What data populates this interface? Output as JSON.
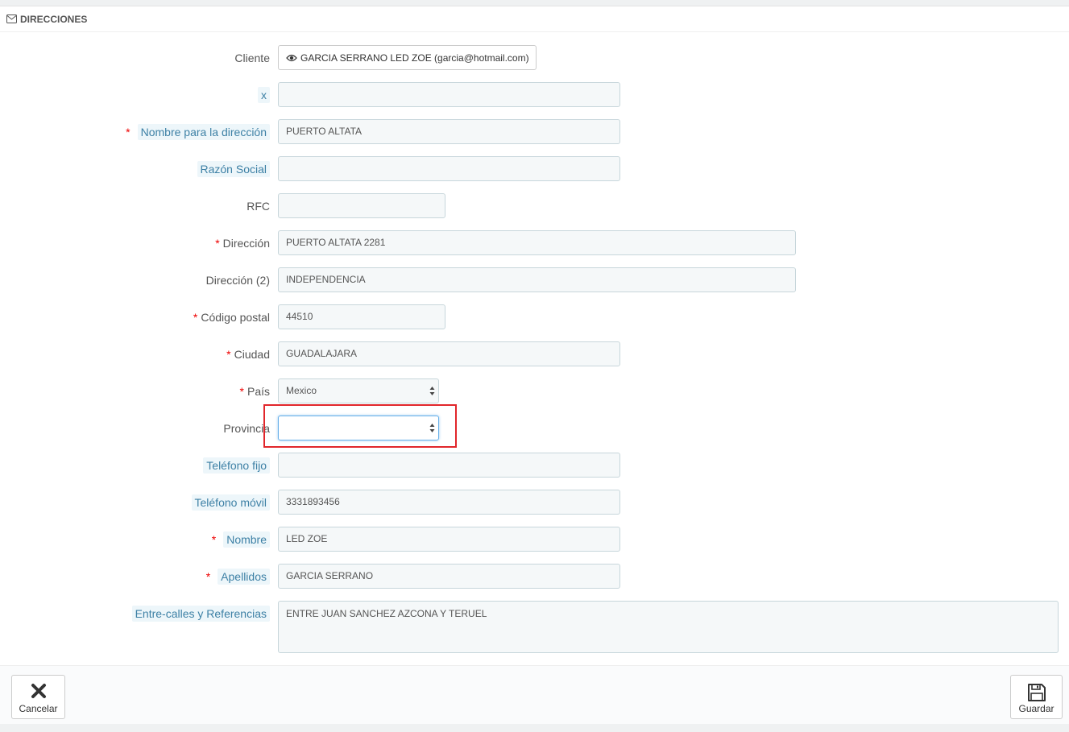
{
  "panel": {
    "title": "DIRECCIONES",
    "title_icon": "envelope-icon"
  },
  "form": {
    "cliente": {
      "label": "Cliente",
      "value": "GARCIA SERRANO LED ZOE (garcia@hotmail.com)",
      "icon": "eye-icon"
    },
    "x": {
      "label": "x",
      "value": ""
    },
    "alias": {
      "label": "Nombre para la dirección",
      "value": "PUERTO ALTATA",
      "required": true
    },
    "company": {
      "label": "Razón Social",
      "value": ""
    },
    "rfc": {
      "label": "RFC",
      "value": ""
    },
    "address1": {
      "label": "Dirección",
      "value": "PUERTO ALTATA 2281",
      "required": true
    },
    "address2": {
      "label": "Dirección (2)",
      "value": "INDEPENDENCIA"
    },
    "postcode": {
      "label": "Código postal",
      "value": "44510",
      "required": true
    },
    "city": {
      "label": "Ciudad",
      "value": "GUADALAJARA",
      "required": true
    },
    "country": {
      "label": "País",
      "value": "Mexico",
      "required": true
    },
    "state": {
      "label": "Provincia",
      "value": ""
    },
    "phone": {
      "label": "Teléfono fijo",
      "value": ""
    },
    "phone_mobile": {
      "label": "Teléfono móvil",
      "value": "3331893456"
    },
    "firstname": {
      "label": "Nombre",
      "value": "LED ZOE",
      "required": true
    },
    "lastname": {
      "label": "Apellidos",
      "value": "GARCIA SERRANO",
      "required": true
    },
    "other": {
      "label": "Entre-calles y Referencias",
      "value": "ENTRE JUAN SANCHEZ AZCONA Y TERUEL"
    },
    "required_marker": "*"
  },
  "footer": {
    "cancel_label": "Cancelar",
    "cancel_icon": "close-icon",
    "save_label": "Guardar",
    "save_icon": "save-icon"
  },
  "colors": {
    "required": "#e00000",
    "hint_text": "#3d80a5",
    "hint_bg": "#edf6fa",
    "field_bg": "#f5f8f9",
    "highlight": "#e1262b"
  }
}
